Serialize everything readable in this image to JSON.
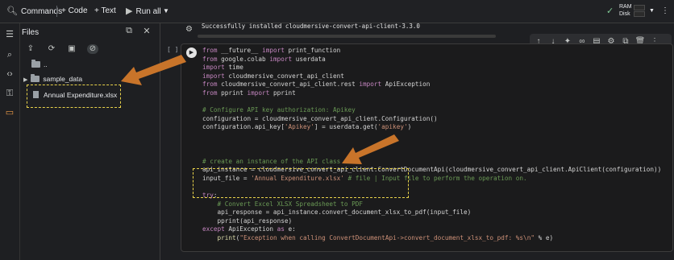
{
  "toolbar": {
    "commands_label": "Commands",
    "code_label": "+ Code",
    "text_label": "+ Text",
    "run_all_label": "Run all",
    "ram_label": "RAM",
    "disk_label": "Disk",
    "checkmark": "✓"
  },
  "files_panel": {
    "title": "Files",
    "parent_dir": "..",
    "items": [
      {
        "name": "sample_data",
        "type": "folder"
      },
      {
        "name": "Annual Expenditure.xlsx",
        "type": "file"
      }
    ]
  },
  "output": {
    "text": "Successfully installed cloudmersive-convert-api-client-3.3.0"
  },
  "cell": {
    "exec_bracket": "[ ]"
  },
  "icons": {
    "accent": "#f09d4a",
    "highlight_box": "#e8d24a",
    "arrow": "#c8742a"
  }
}
